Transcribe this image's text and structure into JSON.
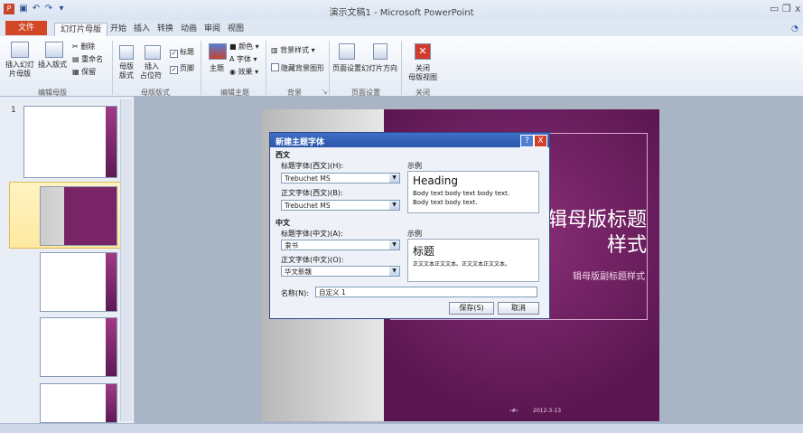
{
  "window": {
    "title": "演示文稿1 - Microsoft PowerPoint",
    "min_glyph": "▭",
    "restore_glyph": "❐",
    "close_glyph": "x"
  },
  "tabs": {
    "file": "文件",
    "items": [
      "幻灯片母版",
      "开始",
      "插入",
      "转换",
      "动画",
      "审阅",
      "视图"
    ]
  },
  "ribbon": {
    "insert_slide_master": "插入幻灯",
    "slide_master_2": "片母版",
    "insert_layout": "插入版式",
    "delete": "删除",
    "rename": "重命名",
    "preserve": "保留",
    "master_layout": "母版",
    "master_layout_2": "版式",
    "insert_placeholder": "插入",
    "insert_placeholder_2": "占位符",
    "title_chk": "标题",
    "footer_chk": "页脚",
    "theme": "主题",
    "colors": "颜色",
    "fonts": "字体",
    "effects": "效果",
    "bg_styles": "背景样式",
    "hide_bg": "隐藏背景图形",
    "page_setup": "页面设置",
    "orientation": "幻灯片方向",
    "close": "关闭",
    "close_2": "母版视图",
    "groups": [
      "编辑母版",
      "母版版式",
      "编辑主题",
      "背景",
      "页面设置",
      "关闭"
    ]
  },
  "slides_pane": {
    "first_num": "1"
  },
  "slide": {
    "title": "辑母版标题样式",
    "subtitle": "辑母版副标题样式",
    "date": "2012-3-13",
    "page_num": "‹#›"
  },
  "dialog": {
    "title": "新建主题字体",
    "help": "?",
    "close": "X",
    "western_header": "西文",
    "heading_font_label": "标题字体(西文)(H):",
    "heading_font_value": "Trebuchet MS",
    "body_font_label": "正文字体(西文)(B):",
    "body_font_value": "Trebuchet MS",
    "sample_label": "示例",
    "sample_heading": "Heading",
    "sample_body_1": "Body text body text body text.",
    "sample_body_2": "Body text body text.",
    "east_header": "中文",
    "heading_font_cn_label": "标题字体(中文)(A):",
    "heading_font_cn_value": "隶书",
    "body_font_cn_label": "正文字体(中文)(O):",
    "body_font_cn_value": "华文新魏",
    "sample_cn_label": "示例",
    "sample_cn_heading": "标题",
    "sample_cn_body": "正文文本正文文本。正文文本正文文本。",
    "name_label": "名称(N):",
    "name_value": "自定义 1",
    "save": "保存(S)",
    "cancel": "取消"
  }
}
